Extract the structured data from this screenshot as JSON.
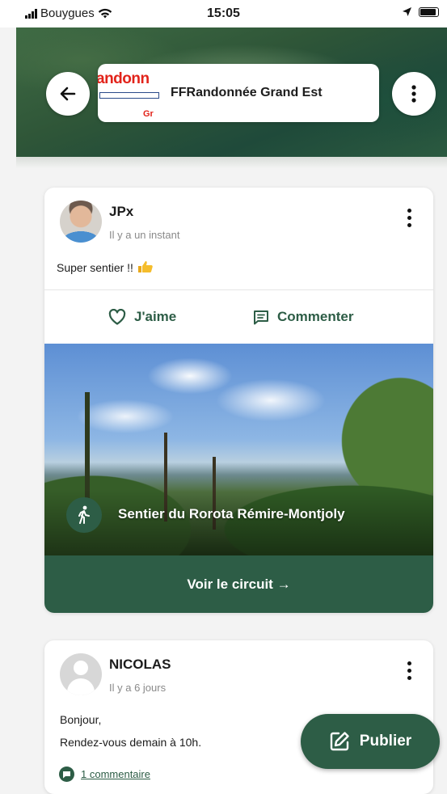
{
  "status_bar": {
    "carrier": "Bouygues",
    "time": "15:05"
  },
  "header": {
    "group_name": "FFRandonnée Grand Est",
    "logo": {
      "text": "andonn",
      "suffix": "Gr",
      "color": "#e2231a"
    }
  },
  "posts": [
    {
      "author": "JPx",
      "time": "Il y a un instant",
      "text": "Super sentier !!",
      "emoji": "thumbs-up",
      "actions": {
        "like": "J'aime",
        "comment": "Commenter"
      },
      "trail": {
        "name": "Sentier du Rorota Rémire-Montjoly",
        "button": "Voir le circuit →"
      }
    },
    {
      "author": "NICOLAS",
      "time": "Il y a 6 jours",
      "text_lines": [
        "Bonjour,",
        "Rendez-vous demain à 10h."
      ],
      "comments_link": "1 commentaire"
    }
  ],
  "fab": {
    "label": "Publier"
  },
  "colors": {
    "accent": "#2d5d46",
    "background": "#f3f3f3",
    "card": "#ffffff"
  }
}
